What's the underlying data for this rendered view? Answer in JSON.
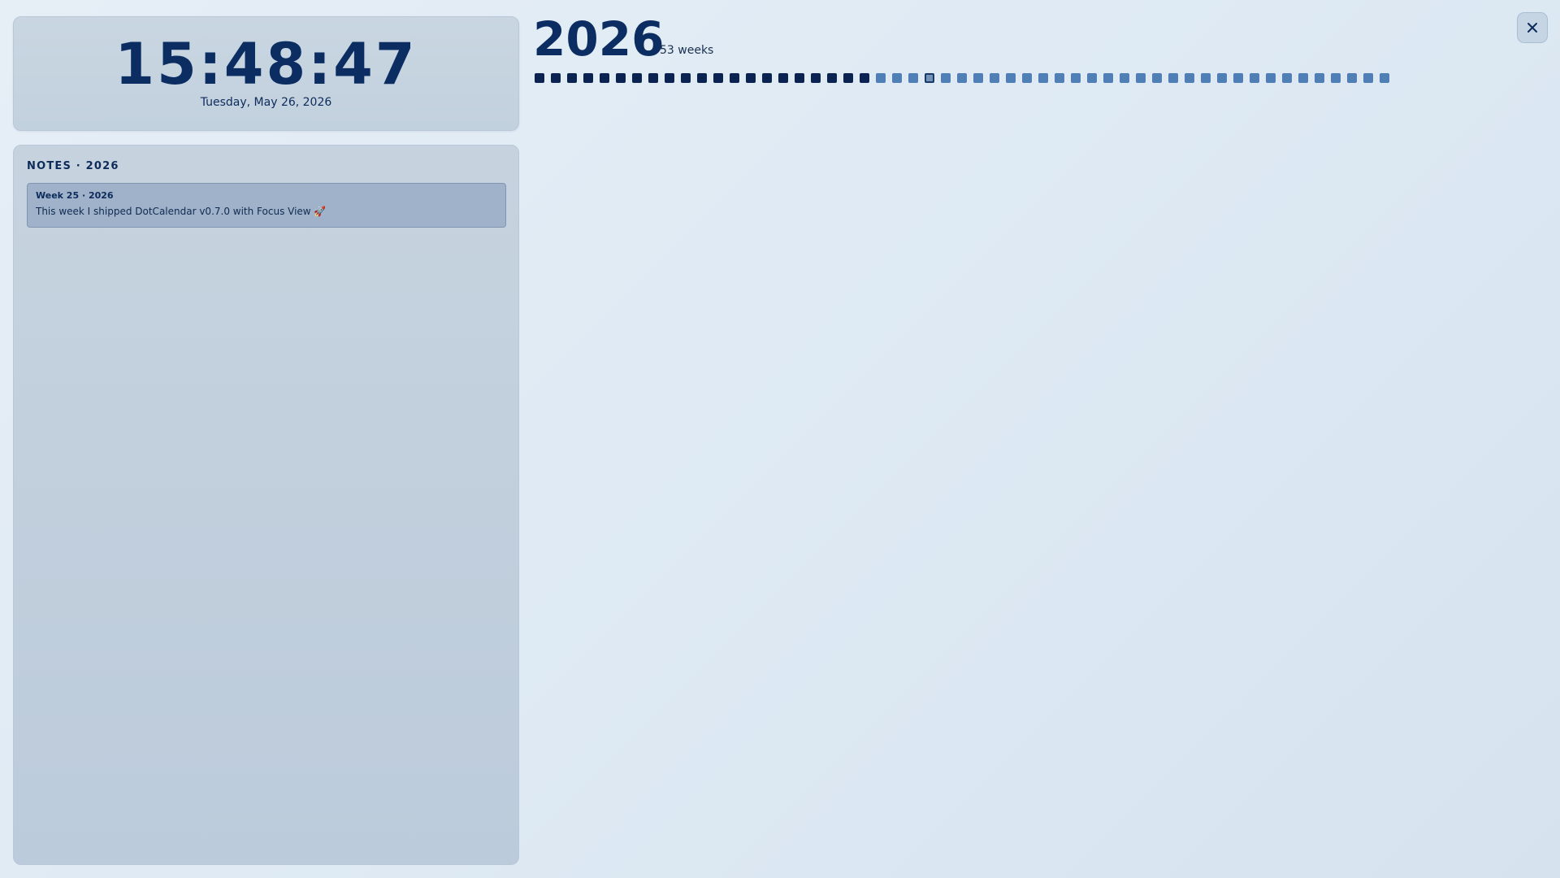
{
  "clock": {
    "time": "15:48:47",
    "date": "Tuesday, May 26, 2026"
  },
  "notes": {
    "header": "NOTES · 2026",
    "items": [
      {
        "week": "Week 25 · 2026",
        "text": "This week I shipped DotCalendar v0.7.0 with Focus View 🚀"
      }
    ]
  },
  "year": {
    "title": "2026",
    "weeks_label": "53 weeks",
    "week_count": 53,
    "past_weeks": 21,
    "current_week": 25
  },
  "colors": {
    "past": "#0b2350",
    "future": "#4f7fb4",
    "current": "#7493b8",
    "accent": "#0b2d62"
  },
  "controls": {
    "close_icon": "close-icon"
  }
}
